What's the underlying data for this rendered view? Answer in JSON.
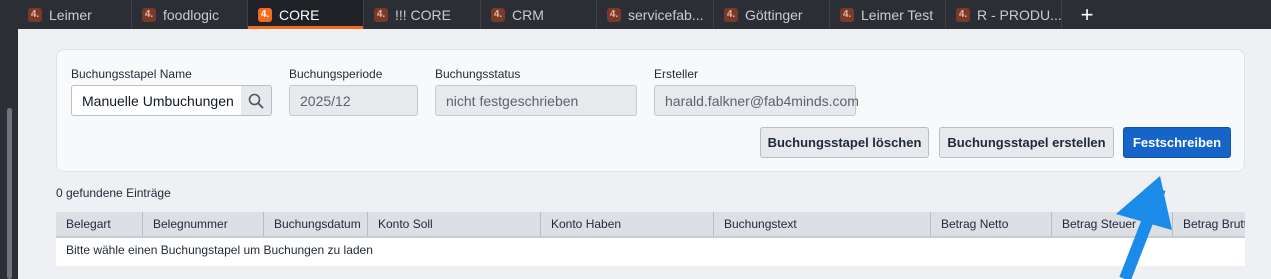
{
  "tabs": [
    {
      "label": "Leimer",
      "icon": "app-logo-icon",
      "active": false
    },
    {
      "label": "foodlogic",
      "icon": "app-logo-icon",
      "active": false
    },
    {
      "label": "CORE",
      "icon": "app-logo-icon",
      "active": true
    },
    {
      "label": "!!! CORE",
      "icon": "app-logo-icon",
      "active": false
    },
    {
      "label": "CRM",
      "icon": "app-logo-icon",
      "active": false
    },
    {
      "label": "servicefab...",
      "icon": "app-logo-icon",
      "active": false
    },
    {
      "label": "Göttinger",
      "icon": "app-logo-icon",
      "active": false
    },
    {
      "label": "Leimer Test",
      "icon": "app-logo-icon",
      "active": false
    },
    {
      "label": "R - PRODU...",
      "icon": "app-logo-icon",
      "active": false
    }
  ],
  "tab_icon_glyph": "4.",
  "new_tab_label": "+",
  "form": {
    "batch_name": {
      "label": "Buchungsstapel Name",
      "value": "Manuelle Umbuchungen"
    },
    "period": {
      "label": "Buchungsperiode",
      "value": "2025/12"
    },
    "status": {
      "label": "Buchungsstatus",
      "value": "nicht festgeschrieben"
    },
    "creator": {
      "label": "Ersteller",
      "value": "harald.falkner@fab4minds.com"
    }
  },
  "buttons": {
    "delete": "Buchungsstapel löschen",
    "create": "Buchungsstapel erstellen",
    "commit": "Festschreiben"
  },
  "entries_count_text": "0 gefundene Einträge",
  "table": {
    "columns": [
      "Belegart",
      "Belegnummer",
      "Buchungsdatum",
      "Konto Soll",
      "Konto Haben",
      "Buchungstext",
      "Betrag Netto",
      "Betrag Steuer",
      "Betrag Brutto"
    ],
    "empty_message": "Bitte wähle einen Buchungstapel um Buchungen zu laden"
  },
  "colors": {
    "accent": "#f26b21",
    "primary": "#1565c8",
    "annotation_arrow": "#1a8be8"
  }
}
